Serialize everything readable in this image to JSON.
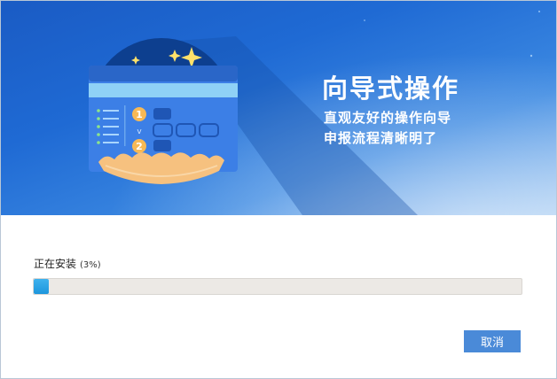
{
  "banner": {
    "title": "向导式操作",
    "line1": "直观友好的操作向导",
    "line2": "申报流程清晰明了",
    "illustration": {
      "step1": "1",
      "step2": "2",
      "arrow": "v"
    }
  },
  "install": {
    "status_label": "正在安装",
    "percent_text": "(3%)",
    "progress": 0.03
  },
  "actions": {
    "cancel_label": "取消"
  },
  "colors": {
    "banner_blue": "#1f6ad4",
    "progress_fill": "#1d96dc",
    "button": "#4a8ad8"
  }
}
